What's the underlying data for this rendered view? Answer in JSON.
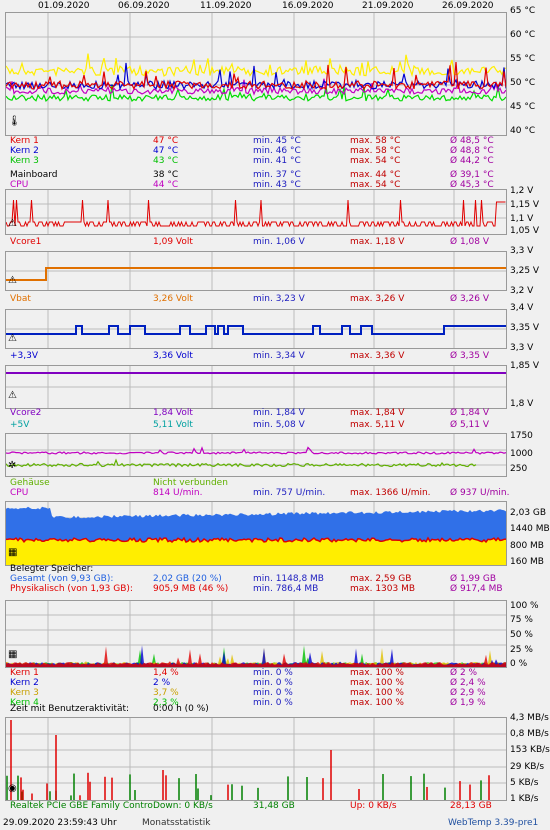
{
  "dates": [
    "01.09.2020",
    "06.09.2020",
    "11.09.2020",
    "16.09.2020",
    "21.09.2020",
    "26.09.2020"
  ],
  "panels": {
    "temp": {
      "yticks": [
        "65 °C",
        "60 °C",
        "55 °C",
        "50 °C",
        "45 °C",
        "40 °C"
      ],
      "rows": [
        {
          "name": "Kern 1",
          "color": "#e00000",
          "val": "47 °C",
          "min": "min. 45 °C",
          "max": "max. 58 °C",
          "avg": "Ø 48,5 °C"
        },
        {
          "name": "Kern 2",
          "color": "#0000d0",
          "val": "47 °C",
          "min": "min. 46 °C",
          "max": "max. 58 °C",
          "avg": "Ø 48,8 °C"
        },
        {
          "name": "Kern 3",
          "color": "#00c000",
          "val": "43 °C",
          "min": "min. 41 °C",
          "max": "max. 54 °C",
          "avg": "Ø 44,2 °C"
        },
        {
          "name": "Mainboard",
          "color": "#000000",
          "val": "38 °C",
          "min": "min. 37 °C",
          "max": "max. 44 °C",
          "avg": "Ø 39,1 °C"
        },
        {
          "name": "CPU",
          "color": "#c000c0",
          "val": "44 °C",
          "min": "min. 43 °C",
          "max": "max. 54 °C",
          "avg": "Ø 45,3 °C"
        }
      ]
    },
    "vcore1": {
      "yticks": [
        "1,2 V",
        "1,15 V",
        "1,1 V",
        "1,05 V"
      ],
      "rows": [
        {
          "name": "Vcore1",
          "color": "#e00000",
          "val": "1,09 Volt",
          "min": "min. 1,06 V",
          "max": "max. 1,18 V",
          "avg": "Ø 1,08 V"
        }
      ]
    },
    "vbat": {
      "yticks": [
        "3,3 V",
        "3,25 V",
        "3,2 V"
      ],
      "rows": [
        {
          "name": "Vbat",
          "color": "#e07000",
          "val": "3,26 Volt",
          "min": "min. 3,23 V",
          "max": "max. 3,26 V",
          "avg": "Ø 3,26 V"
        }
      ]
    },
    "v33": {
      "yticks": [
        "3,4 V",
        "3,35 V",
        "3,3 V"
      ],
      "rows": [
        {
          "name": "+3,3V",
          "color": "#0000d0",
          "val": "3,36 Volt",
          "min": "min. 3,34 V",
          "max": "max. 3,36 V",
          "avg": "Ø 3,35 V"
        }
      ]
    },
    "vcore2": {
      "yticks": [
        "1,85 V",
        "1,8 V"
      ],
      "rows": [
        {
          "name": "Vcore2",
          "color": "#8000c0",
          "val": "1,84 Volt",
          "min": "min. 1,84 V",
          "max": "max. 1,84 V",
          "avg": "Ø 1,84 V"
        },
        {
          "name": "+5V",
          "color": "#00a0a0",
          "val": "5,11 Volt",
          "min": "min. 5,08 V",
          "max": "max. 5,11 V",
          "avg": "Ø 5,11 V"
        }
      ]
    },
    "fan": {
      "yticks": [
        "1750",
        "1000",
        "250"
      ],
      "rows": [
        {
          "name": "Gehäuse",
          "color": "#60b000",
          "val": "Nicht verbunden",
          "min": "",
          "max": "",
          "avg": ""
        },
        {
          "name": "CPU",
          "color": "#c000c0",
          "val": "814 U/min.",
          "min": "min. 757 U/min.",
          "max": "max. 1366 U/min.",
          "avg": "Ø 937 U/min."
        }
      ]
    },
    "mem": {
      "yticks": [
        "2,03 GB",
        "1440 MB",
        "800 MB",
        "160 MB"
      ],
      "title": "Belegter Speicher:",
      "rows": [
        {
          "name": "Gesamt (von 9,93 GB):",
          "color": "#2060e0",
          "val": "2,02 GB (20 %)",
          "min": "min. 1148,8 MB",
          "max": "max. 2,59 GB",
          "avg": "Ø 1,99 GB"
        },
        {
          "name": "Physikalisch (von 1,93 GB):",
          "color": "#e00000",
          "val": "905,9 MB (46 %)",
          "min": "min. 786,4 MB",
          "max": "max. 1303 MB",
          "avg": "Ø 917,4 MB"
        }
      ]
    },
    "load": {
      "yticks": [
        "100 %",
        "75 %",
        "50 %",
        "25 %",
        "0 %"
      ],
      "rows": [
        {
          "name": "Kern 1",
          "color": "#e00000",
          "val": "1,4 %",
          "min": "min. 0 %",
          "max": "max. 100 %",
          "avg": "Ø 2 %"
        },
        {
          "name": "Kern 2",
          "color": "#0000d0",
          "val": "2 %",
          "min": "min. 0 %",
          "max": "max. 100 %",
          "avg": "Ø 2,4 %"
        },
        {
          "name": "Kern 3",
          "color": "#c8a000",
          "val": "3,7 %",
          "min": "min. 0 %",
          "max": "max. 100 %",
          "avg": "Ø 2,9 %"
        },
        {
          "name": "Kern 4",
          "color": "#00c000",
          "val": "2,3 %",
          "min": "min. 0 %",
          "max": "max. 100 %",
          "avg": "Ø 1,9 %"
        }
      ],
      "activity_label": "Zeit mit Benutzeraktivität:",
      "activity_value": "0:00 h (0 %)"
    },
    "net": {
      "yticks": [
        "4,3 MB/s",
        "0,8 MB/s",
        "153 KB/s",
        "29 KB/s",
        "5 KB/s",
        "1 KB/s"
      ],
      "rows": [
        {
          "name": "Realtek PCIe GBE Family Contro",
          "color": "#008000",
          "val": "Down: 0 KB/s",
          "min": "31,48 GB",
          "max": "Up: 0 KB/s",
          "avg": "28,13 GB",
          "maxcolor": "#e00000",
          "avgcolor": "#e00000"
        }
      ]
    }
  },
  "footer": {
    "timestamp": "29.09.2020 23:59:43 Uhr",
    "mode": "Monatsstatistik",
    "version": "WebTemp 3.39-pre1"
  }
}
